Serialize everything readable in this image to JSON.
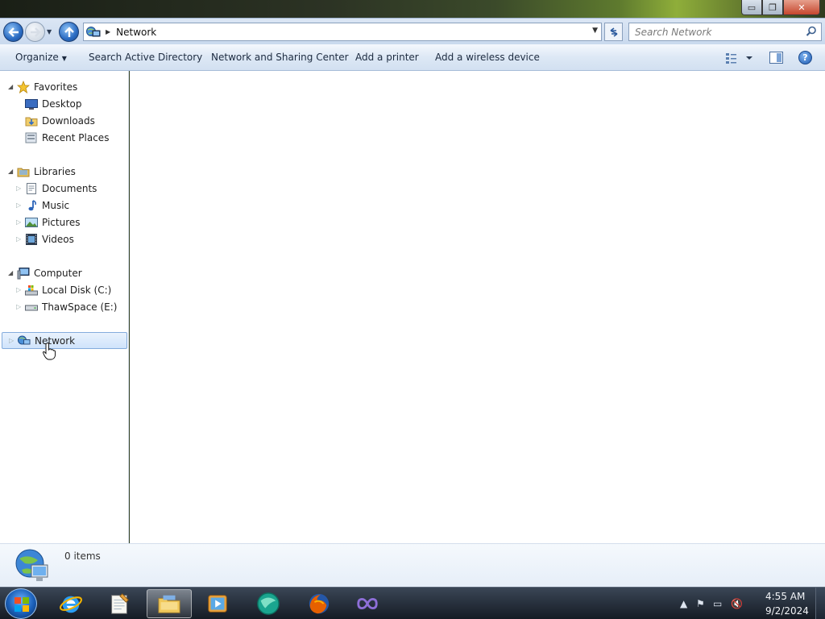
{
  "window": {
    "caption_buttons": {
      "minimize": "▭",
      "restore": "❐",
      "close": "✕"
    }
  },
  "address_bar": {
    "breadcrumb": [
      "Network"
    ],
    "search_placeholder": "Search Network"
  },
  "command_bar": {
    "organize": "Organize",
    "items": [
      "Search Active Directory",
      "Network and Sharing Center",
      "Add a printer",
      "Add a wireless device"
    ],
    "help": "?"
  },
  "nav_tree": {
    "favorites": {
      "label": "Favorites",
      "children": [
        "Desktop",
        "Downloads",
        "Recent Places"
      ]
    },
    "libraries": {
      "label": "Libraries",
      "children": [
        "Documents",
        "Music",
        "Pictures",
        "Videos"
      ]
    },
    "computer": {
      "label": "Computer",
      "children": [
        "Local Disk (C:)",
        "ThawSpace (E:)"
      ]
    },
    "network": {
      "label": "Network",
      "selected": true
    }
  },
  "details_pane": {
    "item_count": "0 items"
  },
  "taskbar": {
    "apps": [
      "internet-explorer",
      "notepad",
      "windows-explorer",
      "media-player",
      "browser-globe",
      "firefox",
      "visual-studio"
    ],
    "active_app": "windows-explorer",
    "clock_time": "4:55 AM",
    "clock_date": "9/2/2024"
  },
  "colors": {
    "selection_bg": "#cfe3fb",
    "selection_border": "#84acdd",
    "command_text": "#1d2b40"
  }
}
